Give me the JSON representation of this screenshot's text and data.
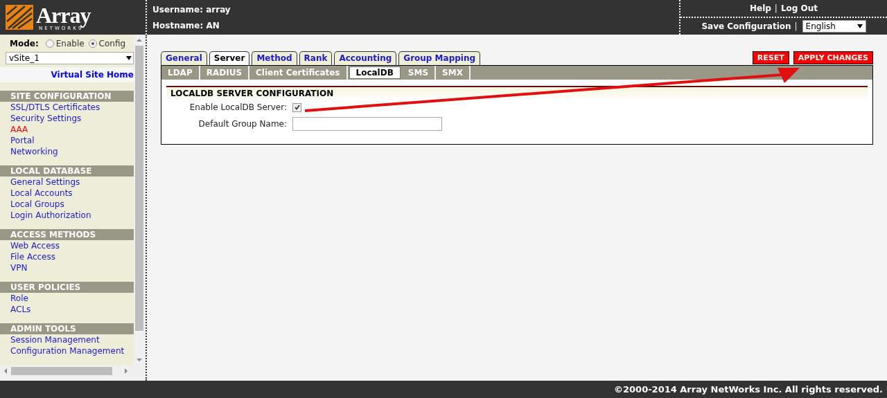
{
  "header": {
    "logo": {
      "brand": "Array",
      "sub": "NETWORKS"
    },
    "username": "Username: array",
    "hostname": "Hostname: AN",
    "top_links": [
      {
        "kind": "link",
        "text": "Help"
      },
      {
        "kind": "sep",
        "text": "|"
      },
      {
        "kind": "link",
        "text": "Log Out"
      }
    ],
    "bottom_links": [
      {
        "kind": "link",
        "text": "Save Configuration"
      },
      {
        "kind": "sep",
        "text": "|"
      }
    ],
    "language": "English"
  },
  "sidebar": {
    "mode_label": "Mode:",
    "modes": [
      {
        "label": "Enable",
        "selected": false
      },
      {
        "label": "Config",
        "selected": true
      }
    ],
    "site": "vSite_1",
    "home_link": "Virtual Site Home",
    "sections": [
      {
        "title": "SITE CONFIGURATION",
        "items": [
          {
            "label": "SSL/DTLS Certificates",
            "selected": false
          },
          {
            "label": "Security Settings",
            "selected": false
          },
          {
            "label": "AAA",
            "selected": true
          },
          {
            "label": "Portal",
            "selected": false
          },
          {
            "label": "Networking",
            "selected": false
          }
        ]
      },
      {
        "title": "LOCAL DATABASE",
        "items": [
          {
            "label": "General Settings",
            "selected": false
          },
          {
            "label": "Local Accounts",
            "selected": false
          },
          {
            "label": "Local Groups",
            "selected": false
          },
          {
            "label": "Login Authorization",
            "selected": false
          }
        ]
      },
      {
        "title": "ACCESS METHODS",
        "items": [
          {
            "label": "Web Access",
            "selected": false
          },
          {
            "label": "File Access",
            "selected": false
          },
          {
            "label": "VPN",
            "selected": false
          }
        ]
      },
      {
        "title": "USER POLICIES",
        "items": [
          {
            "label": "Role",
            "selected": false
          },
          {
            "label": "ACLs",
            "selected": false
          }
        ]
      },
      {
        "title": "ADMIN TOOLS",
        "items": [
          {
            "label": "Session Management",
            "selected": false
          },
          {
            "label": "Configuration Management",
            "selected": false
          }
        ]
      }
    ]
  },
  "tabs": [
    {
      "label": "General",
      "selected": false
    },
    {
      "label": "Server",
      "selected": true
    },
    {
      "label": "Method",
      "selected": false
    },
    {
      "label": "Rank",
      "selected": false
    },
    {
      "label": "Accounting",
      "selected": false
    },
    {
      "label": "Group Mapping",
      "selected": false
    }
  ],
  "subtabs": [
    {
      "label": "LDAP",
      "selected": false
    },
    {
      "label": "RADIUS",
      "selected": false
    },
    {
      "label": "Client Certificates",
      "selected": false
    },
    {
      "label": "LocalDB",
      "selected": true
    },
    {
      "label": "SMS",
      "selected": false
    },
    {
      "label": "SMX",
      "selected": false
    }
  ],
  "buttons": [
    "RESET",
    "APPLY CHANGES"
  ],
  "section_title": "LOCALDB SERVER CONFIGURATION",
  "fields": [
    {
      "kind": "checkbox",
      "label": "Enable LocalDB Server:",
      "checked": true
    },
    {
      "kind": "text",
      "label": "Default Group Name:"
    }
  ],
  "footer": "©2000-2014 Array NetWorks Inc. All rights reserved."
}
